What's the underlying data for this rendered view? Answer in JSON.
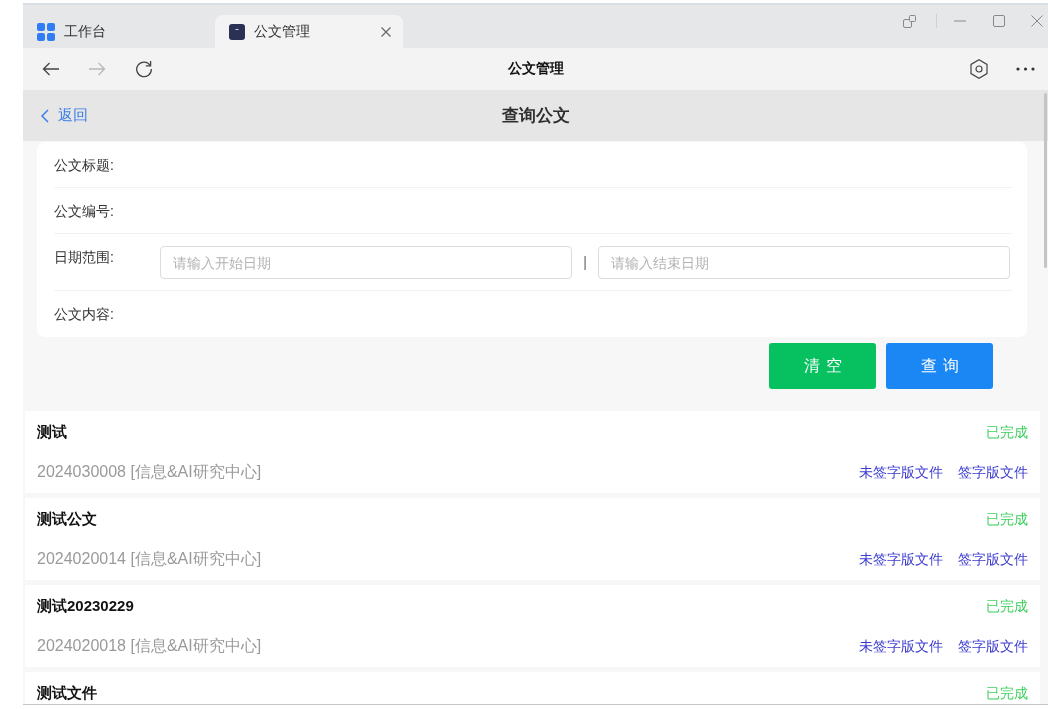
{
  "browser": {
    "tabs": [
      {
        "kind": "home",
        "label": "工作台",
        "selected": false
      },
      {
        "kind": "page",
        "label": "公文管理",
        "selected": true
      }
    ],
    "toolbar": {
      "title": "公文管理",
      "back_disabled": false,
      "forward_disabled": true
    }
  },
  "header": {
    "back_label": "返回",
    "title": "查询公文"
  },
  "form": {
    "fields": [
      {
        "kind": "text",
        "label": "公文标题:"
      },
      {
        "kind": "text",
        "label": "公文编号:"
      },
      {
        "kind": "date_range",
        "label": "日期范围:",
        "start_placeholder": "请输入开始日期",
        "separator": "|",
        "end_placeholder": "请输入结束日期"
      },
      {
        "kind": "text",
        "label": "公文内容:"
      }
    ]
  },
  "buttons": [
    {
      "kind": "reset",
      "label": "清空"
    },
    {
      "kind": "submit",
      "label": "查询"
    }
  ],
  "documents": [
    {
      "title": "测试",
      "status": "已完成",
      "number": "2024030008 [信息&AI研究中心]",
      "links": [
        "未签字版文件",
        "签字版文件"
      ]
    },
    {
      "title": "测试公文",
      "status": "已完成",
      "number": "2024020014 [信息&AI研究中心]",
      "links": [
        "未签字版文件",
        "签字版文件"
      ]
    },
    {
      "title": "测试20230229",
      "status": "已完成",
      "number": "2024020018 [信息&AI研究中心]",
      "links": [
        "未签字版文件",
        "签字版文件"
      ]
    },
    {
      "title": "测试文件",
      "status": "已完成"
    }
  ]
}
